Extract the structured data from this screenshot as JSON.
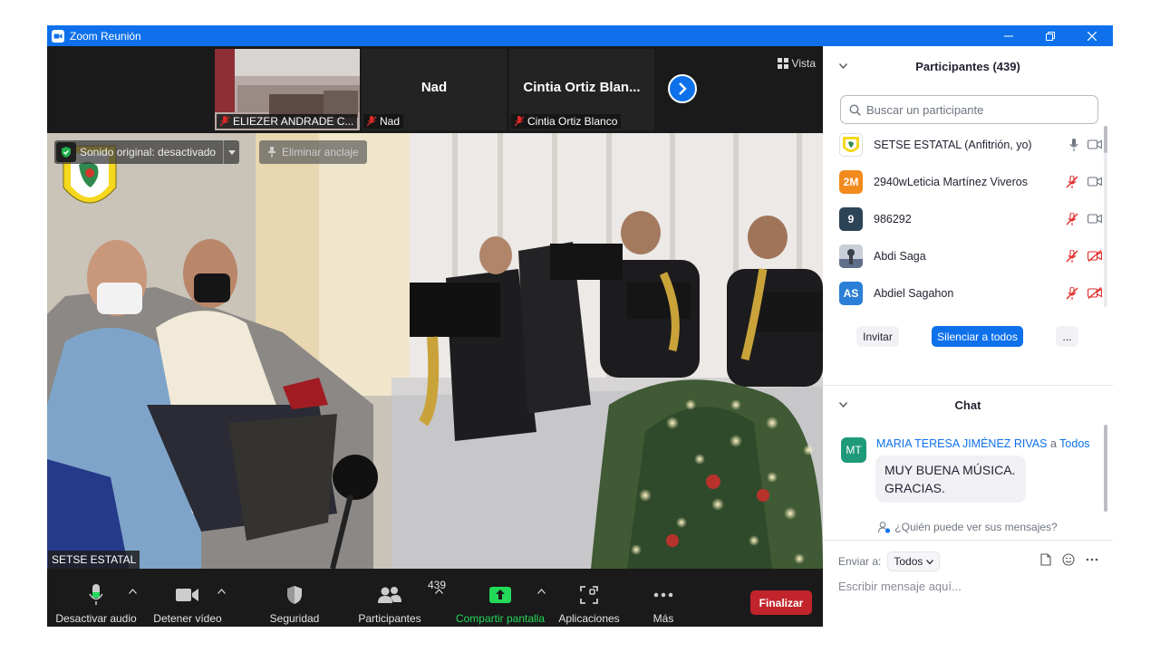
{
  "window": {
    "title": "Zoom Reunión"
  },
  "strip": {
    "thumbs": [
      {
        "name": "ELIEZER ANDRADE C...",
        "big": ""
      },
      {
        "name": "Nad",
        "big": "Nad"
      },
      {
        "name": "Cintia Ortiz Blanco",
        "big": "Cintia  Ortiz  Blan..."
      }
    ],
    "view_label": "Vista"
  },
  "main": {
    "original_sound": "Sonido original: desactivado",
    "unpin_label": "Eliminar anclaje",
    "speaker": "SETSE ESTATAL"
  },
  "toolbar": {
    "audio": "Desactivar audio",
    "video": "Detener vídeo",
    "security": "Seguridad",
    "participants": "Participantes",
    "participants_count": "439",
    "share": "Compartir pantalla",
    "apps": "Aplicaciones",
    "more": "Más",
    "end": "Finalizar"
  },
  "participants": {
    "header": "Participantes (439)",
    "search_placeholder": "Buscar un participante",
    "list": [
      {
        "name": "SETSE ESTATAL (Anfitrión, yo)",
        "initials": "",
        "color": "#ffffff"
      },
      {
        "name": "2940wLeticia Martínez Viveros",
        "initials": "2M",
        "color": "#f28a1e"
      },
      {
        "name": "986292",
        "initials": "9",
        "color": "#2d4356"
      },
      {
        "name": "Abdi Saga",
        "initials": "",
        "color": "#8a8f99"
      },
      {
        "name": "Abdiel Sagahon",
        "initials": "AS",
        "color": "#2b7fd6"
      }
    ],
    "invite": "Invitar",
    "mute_all": "Silenciar a todos",
    "more": "..."
  },
  "chat": {
    "header": "Chat",
    "message": {
      "initials": "MT",
      "sender": "MARIA TERESA JIMÉNEZ RIVAS",
      "to_word": "a",
      "to": "Todos",
      "text": "MUY BUENA MÚSICA. GRACIAS."
    },
    "who_can_see": "¿Quién puede ver sus mensajes?",
    "send_to_label": "Enviar a:",
    "send_to_value": "Todos",
    "input_placeholder": "Escribir mensaje aquí..."
  },
  "colors": {
    "zoom_blue": "#0e71eb",
    "end_red": "#c2242b",
    "share_green": "#23d959"
  }
}
